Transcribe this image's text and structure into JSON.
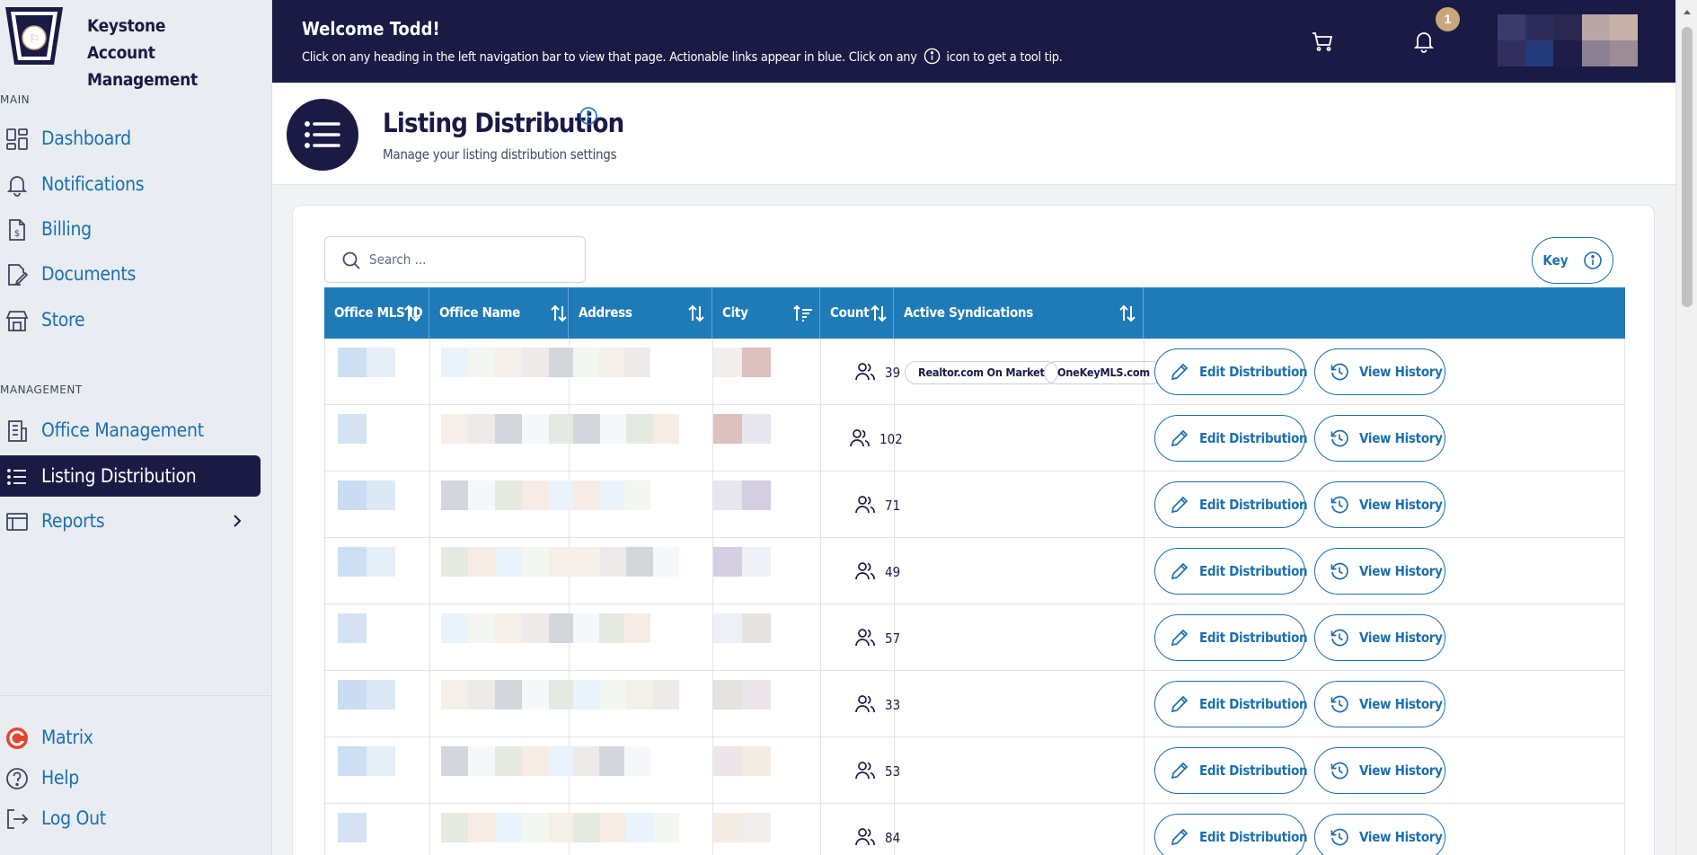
{
  "app": {
    "name": "Keystone Account Management"
  },
  "sidebar": {
    "sections": [
      {
        "label": "MAIN"
      },
      {
        "label": "MANAGEMENT"
      }
    ],
    "items": [
      {
        "label": "Dashboard",
        "icon": "dashboard-icon"
      },
      {
        "label": "Notifications",
        "icon": "bell-icon"
      },
      {
        "label": "Billing",
        "icon": "billing-icon"
      },
      {
        "label": "Documents",
        "icon": "document-edit-icon"
      },
      {
        "label": "Store",
        "icon": "store-icon"
      },
      {
        "label": "Office Management",
        "icon": "building-icon"
      },
      {
        "label": "Listing Distribution",
        "icon": "list-icon",
        "active": true
      },
      {
        "label": "Reports",
        "icon": "reports-icon"
      }
    ],
    "footer_items": [
      {
        "label": "Matrix",
        "icon": "matrix-icon"
      },
      {
        "label": "Help",
        "icon": "help-icon"
      },
      {
        "label": "Log Out",
        "icon": "logout-icon"
      }
    ]
  },
  "topbar": {
    "welcome": "Welcome Todd!",
    "subtext_before": "Click on any heading in the left navigation bar to view that page. Actionable links appear in blue. Click on any",
    "subtext_after": "icon to get a tool tip.",
    "notification_count": "1"
  },
  "page": {
    "title": "Listing Distribution",
    "subtitle": "Manage your listing distribution settings"
  },
  "search": {
    "placeholder": "Search ..."
  },
  "key_button": {
    "label": "Key"
  },
  "table": {
    "columns": [
      {
        "label": "Office MLS ID",
        "sort": "both"
      },
      {
        "label": "Office Name",
        "sort": "both"
      },
      {
        "label": "Address",
        "sort": "both"
      },
      {
        "label": "City",
        "sort": "ascending"
      },
      {
        "label": "Count",
        "sort": "both"
      },
      {
        "label": "Active Syndications",
        "sort": "both"
      }
    ],
    "rows": [
      {
        "count": "39",
        "syndications": [
          "Realtor.com On Market",
          "OneKeyMLS.com"
        ]
      },
      {
        "count": "102",
        "syndications": []
      },
      {
        "count": "71",
        "syndications": []
      },
      {
        "count": "49",
        "syndications": []
      },
      {
        "count": "57",
        "syndications": []
      },
      {
        "count": "33",
        "syndications": []
      },
      {
        "count": "53",
        "syndications": []
      },
      {
        "count": "84",
        "syndications": []
      }
    ],
    "edit_label": "Edit Distribution",
    "history_label": "View History"
  },
  "colors": {
    "navy": "#1b1a45",
    "link_blue": "#1c6fb0",
    "table_header": "#1f7bb8",
    "badge": "#c9a77c"
  }
}
